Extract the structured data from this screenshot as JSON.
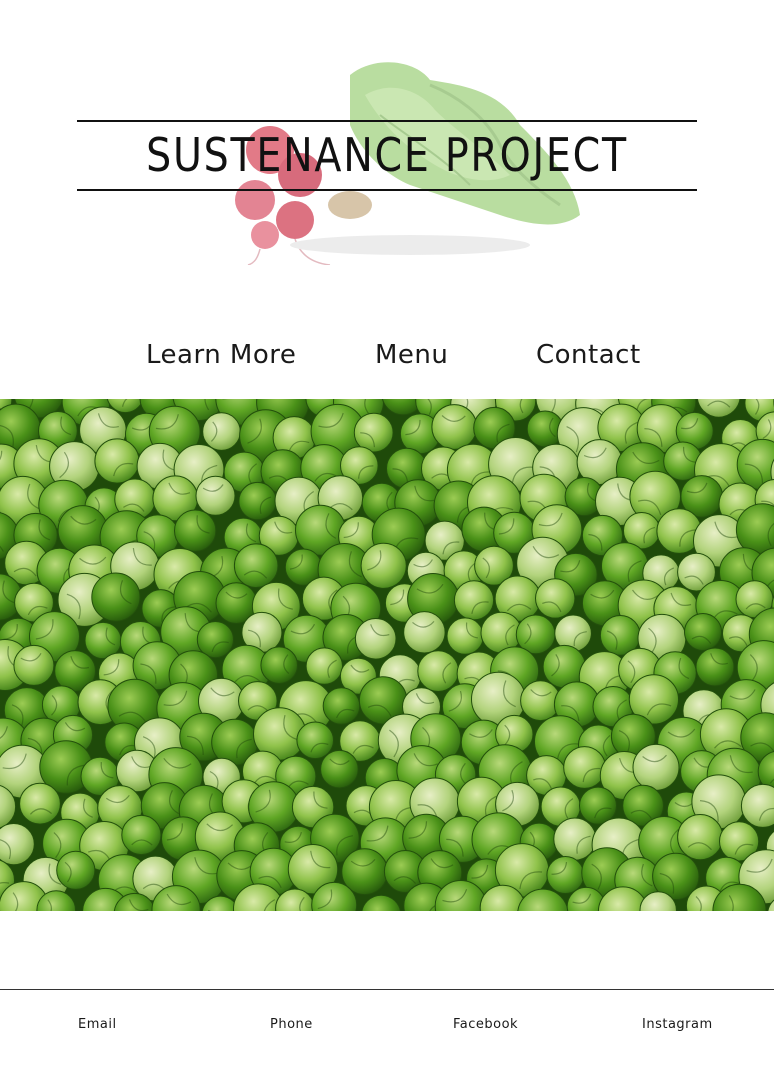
{
  "site": {
    "title": "SUSTENANCE PROJECT",
    "logo_art": "radish-bunch-illustration"
  },
  "nav": {
    "items": [
      {
        "label": "Learn More"
      },
      {
        "label": "Menu"
      },
      {
        "label": "Contact"
      }
    ]
  },
  "hero": {
    "image": "brussels-sprouts-photo"
  },
  "footer": {
    "links": [
      {
        "label": "Email"
      },
      {
        "label": "Phone"
      },
      {
        "label": "Facebook"
      },
      {
        "label": "Instagram"
      }
    ]
  },
  "colors": {
    "text": "#111111",
    "rule": "#111111",
    "sprout_dark": "#2f6b12",
    "sprout_mid": "#4f9a1e",
    "sprout_light": "#b9d98a",
    "radish": "#d23a4a",
    "leaf": "#8fc46a"
  }
}
